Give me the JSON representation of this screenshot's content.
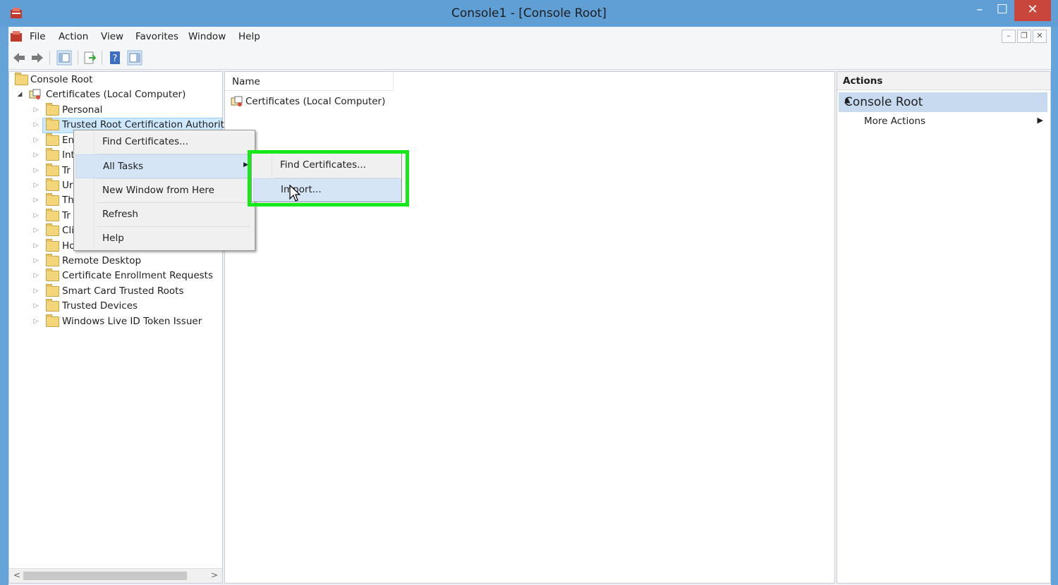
{
  "window": {
    "title": "Console1 - [Console Root]",
    "controls": {
      "minimize": "–",
      "maximize": "☐",
      "close": "✕"
    }
  },
  "menu": [
    "File",
    "Action",
    "View",
    "Favorites",
    "Window",
    "Help"
  ],
  "toolbar": {
    "icons": [
      "back-icon",
      "forward-icon",
      "show-hide-console-tree-icon",
      "export-list-icon",
      "help-icon",
      "show-hide-action-pane-icon"
    ]
  },
  "tree": {
    "root": "Console Root",
    "computer": "Certificates (Local Computer)",
    "items": [
      "Personal",
      "Trusted Root Certification Authoritie",
      "En",
      "Int",
      "Tr",
      "Ur",
      "Th",
      "Tr",
      "Cli",
      "Ho",
      "Remote Desktop",
      "Certificate Enrollment Requests",
      "Smart Card Trusted Roots",
      "Trusted Devices",
      "Windows Live ID Token Issuer"
    ],
    "selected_index": 1
  },
  "list": {
    "column_name": "Name",
    "rows": [
      "Certificates (Local Computer)"
    ]
  },
  "actions": {
    "header": "Actions",
    "section": "Console Root",
    "more": "More Actions"
  },
  "context_menu": {
    "items": [
      "Find Certificates...",
      "All Tasks",
      "New Window from Here",
      "Refresh",
      "Help"
    ],
    "highlighted": "All Tasks"
  },
  "submenu": {
    "items": [
      "Find Certificates...",
      "Import..."
    ],
    "highlighted": "Import..."
  },
  "colors": {
    "title_bar": "#5f9fd6",
    "highlight_box": "#17e81a",
    "close_button": "#c9463d"
  }
}
